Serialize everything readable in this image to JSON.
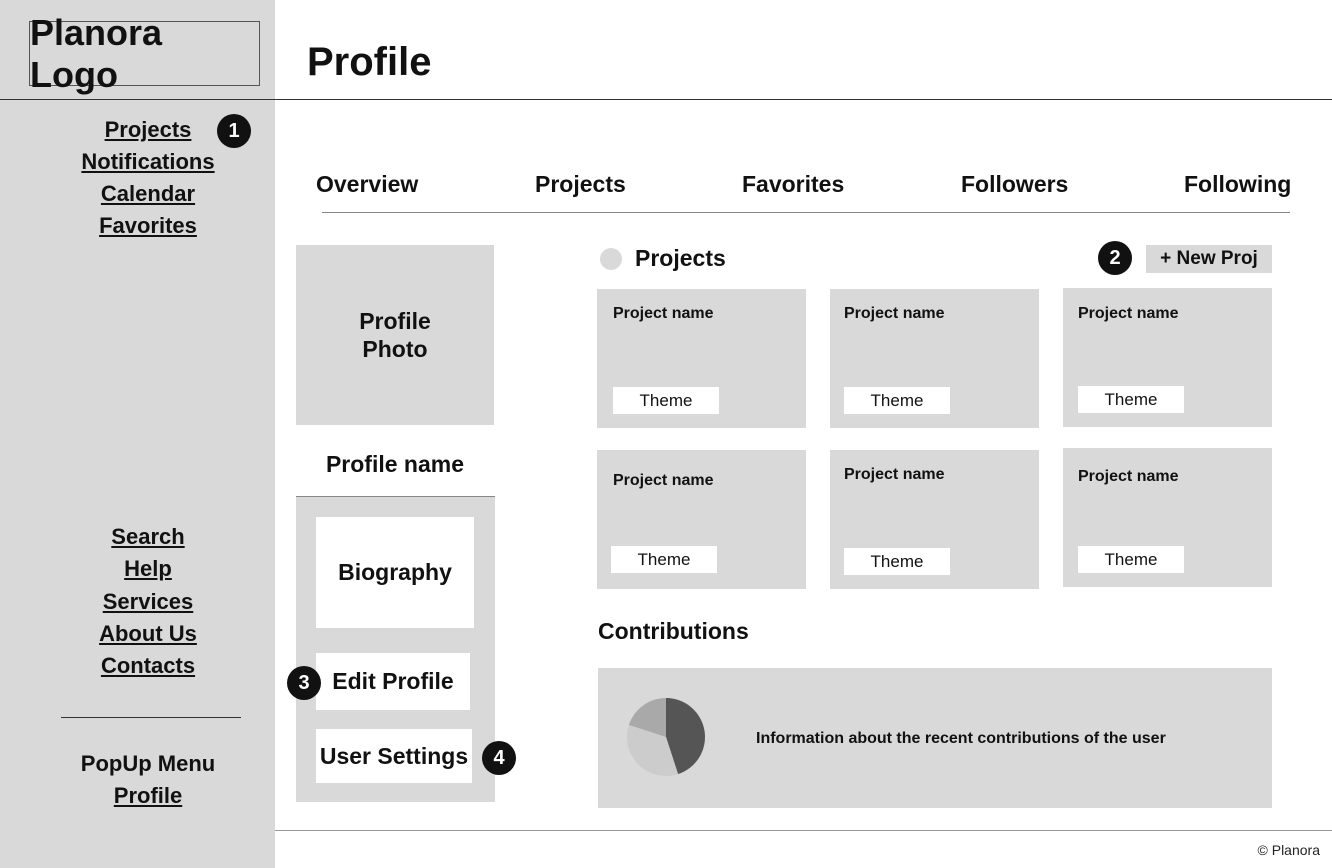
{
  "logo": "Planora Logo",
  "page_title": "Profile",
  "sidebar": {
    "top_links": [
      "Projects",
      "Notifications",
      "Calendar",
      "Favorites"
    ],
    "bottom_links": [
      "Search",
      "Help",
      "Services",
      "About Us",
      "Contacts"
    ],
    "popup_label": "PopUp Menu",
    "profile_link": "Profile"
  },
  "markers": [
    "1",
    "2",
    "3",
    "4"
  ],
  "tabs": [
    "Overview",
    "Projects",
    "Favorites",
    "Followers",
    "Following"
  ],
  "profile": {
    "photo_line1": "Profile",
    "photo_line2": "Photo",
    "name": "Profile name",
    "biography": "Biography",
    "edit_profile": "Edit Profile",
    "user_settings": "User Settings"
  },
  "projects": {
    "heading": "Projects",
    "new_button": "+ New Proj",
    "cards": [
      {
        "name": "Project name",
        "theme": "Theme"
      },
      {
        "name": "Project name",
        "theme": "Theme"
      },
      {
        "name": "Project name",
        "theme": "Theme"
      },
      {
        "name": "Project name",
        "theme": "Theme"
      },
      {
        "name": "Project name",
        "theme": "Theme"
      },
      {
        "name": "Project name",
        "theme": "Theme"
      }
    ]
  },
  "contributions": {
    "heading": "Contributions",
    "text": "Information about the recent contributions of the user",
    "pie_slices": [
      0.45,
      0.35,
      0.2
    ],
    "pie_colors": [
      "#555555",
      "#cccccc",
      "#a9a9a9"
    ]
  },
  "footer": "© Planora"
}
